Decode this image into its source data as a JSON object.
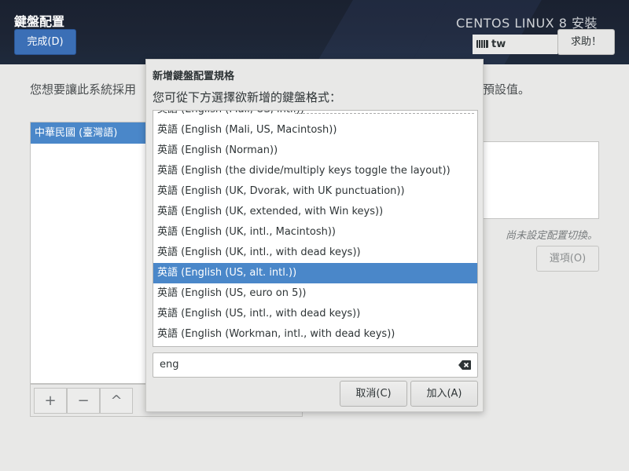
{
  "header": {
    "title": "鍵盤配置",
    "done_label": "完成(D)",
    "product": "CENTOS LINUX 8 安裝",
    "keyboard_indicator": "tw",
    "help_label": "求助！"
  },
  "main": {
    "intro_text": "您想要讓此系統採用",
    "intro_text_end": "預設值。",
    "layouts": [
      "中華民國 (臺灣語)"
    ],
    "toolbar": {
      "add": "+",
      "remove": "−",
      "up": "^"
    },
    "switch_note": "尚未設定配置切換。",
    "options_label": "選項(O)"
  },
  "dialog": {
    "title": "新增鍵盤配置規格",
    "prompt": "您可從下方選擇欲新增的鍵盤格式：",
    "items": [
      "英語 (English (Mali, US, intl.))",
      "英語 (English (Mali, US, Macintosh))",
      "英語 (English (Norman))",
      "英語 (English (the divide/multiply keys toggle the layout))",
      "英語 (English (UK, Dvorak, with UK punctuation))",
      "英語 (English (UK, extended, with Win keys))",
      "英語 (English (UK, intl., Macintosh))",
      "英語 (English (UK, intl., with dead keys))",
      "英語 (English (US, alt. intl.))",
      "英語 (English (US, euro on 5))",
      "英語 (English (US, intl., with dead keys))",
      "英語 (English (Workman, intl., with dead keys))"
    ],
    "selected_index": 8,
    "search_value": "eng",
    "cancel_label": "取消(C)",
    "add_label": "加入(A)"
  },
  "colors": {
    "accent": "#4a87c9",
    "header_bg": "#1d2535",
    "done_button": "#3b6fb6"
  }
}
